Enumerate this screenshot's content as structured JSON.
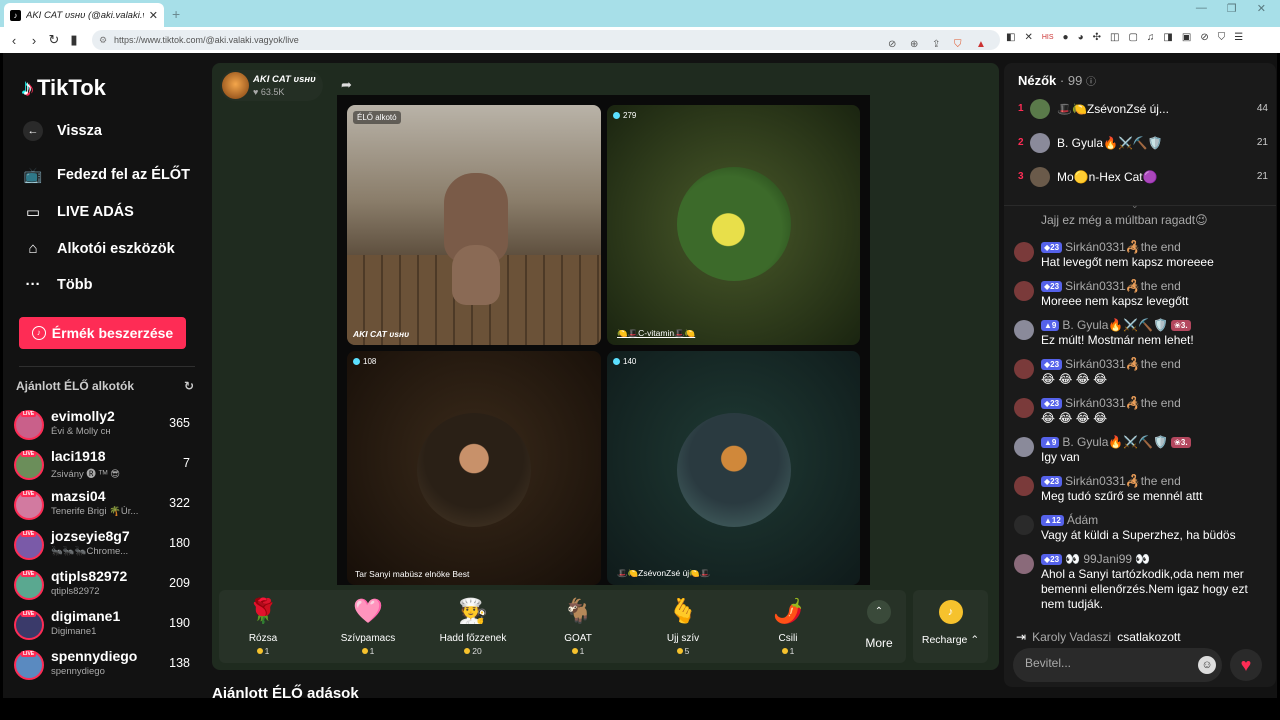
{
  "browser": {
    "tab_title": "AKI CAT ᴜsʜᴜ (@aki.valaki.va",
    "new_tab": "+",
    "url": "https://www.tiktok.com/@aki.valaki.vagyok/live"
  },
  "sidebar": {
    "logo": "TikTok",
    "back": "Vissza",
    "nav": [
      {
        "label": "Fedezd fel az ÉLŐT",
        "icon": "live-tv-icon"
      },
      {
        "label": "LIVE ADÁS",
        "icon": "camera-icon"
      },
      {
        "label": "Alkotói eszközök",
        "icon": "home-play-icon"
      },
      {
        "label": "Több",
        "icon": "more-dots-icon"
      }
    ],
    "coins_button": "Érmék beszerzése",
    "recommended_heading": "Ajánlott ÉLŐ alkotók",
    "live_badge": "LIVE",
    "recommended": [
      {
        "name": "evimolly2",
        "sub": "Évi & Molly ᴄʜ",
        "count": "365",
        "color": "#c9608a"
      },
      {
        "name": "laci1918",
        "sub": "Zsivány 🅡 ᵀᴹ 😎",
        "count": "7",
        "color": "#6b8e5a"
      },
      {
        "name": "mazsi04",
        "sub": "Tenerife Brigi 🌴Úr...",
        "count": "322",
        "color": "#d27aa0"
      },
      {
        "name": "jozseyie8g7",
        "sub": "🐜🐜🐜Chrome...",
        "count": "180",
        "color": "#7a5aa8"
      },
      {
        "name": "qtipls82972",
        "sub": "qtipls82972",
        "count": "209",
        "color": "#5aa890"
      },
      {
        "name": "digimane1",
        "sub": "Digimane1",
        "count": "190",
        "color": "#3a3a6a"
      },
      {
        "name": "spennydiego",
        "sub": "spennydiego",
        "count": "138",
        "color": "#5a8ac0"
      }
    ]
  },
  "stream": {
    "host_name": "AKI CAT ᴜsʜᴜ",
    "likes": "♥ 63.5K",
    "cells": [
      {
        "tag": "ÉLŐ alkotó",
        "caption": "AKI CAT ᴜsʜᴜ"
      },
      {
        "viewers": "279",
        "caption": "🍋🎩C-vitamin🎩🍋"
      },
      {
        "viewers": "108",
        "caption": "Tar Sanyi mabüsz elnöke Best"
      },
      {
        "viewers": "140",
        "caption": "🎩🍋ZsévonZsé új🍋🎩"
      }
    ]
  },
  "gifts": [
    {
      "name": "Rózsa",
      "price": "1",
      "icon": "🌹"
    },
    {
      "name": "Szívpamacs",
      "price": "1",
      "icon": "🩷"
    },
    {
      "name": "Hadd főzzenek",
      "price": "20",
      "icon": "🧑‍🍳"
    },
    {
      "name": "GOAT",
      "price": "1",
      "icon": "🐐"
    },
    {
      "name": "Ujj szív",
      "price": "5",
      "icon": "🫰"
    },
    {
      "name": "Csili",
      "price": "1",
      "icon": "🌶️"
    }
  ],
  "gift_more": "More",
  "recharge": "Recharge",
  "suggested_heading": "Ajánlott ÉLŐ adások",
  "chat": {
    "viewers_label": "Nézők",
    "viewers_count": "· 99",
    "top_viewers": [
      {
        "rank": "1",
        "name": "🎩🍋ZsévonZsé új...",
        "score": "44",
        "color": "#5a7a4a"
      },
      {
        "rank": "2",
        "name": "B. Gyula🔥⚔️⛏️🛡️",
        "score": "21",
        "color": "#8a8a9a"
      },
      {
        "rank": "3",
        "name": "Mo🟡n-Hex Cat🟣",
        "score": "21",
        "color": "#6a5a4a"
      }
    ],
    "messages": [
      {
        "user": "",
        "badge": "",
        "extra": "",
        "body": "Jajj ez még a múltban ragadt😉",
        "color": "#444"
      },
      {
        "user": "Sirkán0331🦂the end",
        "badge": "◆23",
        "extra": "",
        "body": "Hat levegőt nem kapsz moreeee",
        "color": "#7a3a3a"
      },
      {
        "user": "Sirkán0331🦂the end",
        "badge": "◆23",
        "extra": "",
        "body": "Moreee nem kapsz levegőtt",
        "color": "#7a3a3a"
      },
      {
        "user": "B. Gyula🔥⚔️⛏️🛡️",
        "badge": "▲9",
        "extra": "❀3.",
        "body": "Ez múlt! Mostmár nem lehet!",
        "color": "#8a8a9a"
      },
      {
        "user": "Sirkán0331🦂the end",
        "badge": "◆23",
        "extra": "",
        "body": "😂 😂 😂 😂",
        "color": "#7a3a3a"
      },
      {
        "user": "Sirkán0331🦂the end",
        "badge": "◆23",
        "extra": "",
        "body": "😂 😂 😂 😂",
        "color": "#7a3a3a"
      },
      {
        "user": "B. Gyula🔥⚔️⛏️🛡️",
        "badge": "▲9",
        "extra": "❀3.",
        "body": "Igy van",
        "color": "#8a8a9a"
      },
      {
        "user": "Sirkán0331🦂the end",
        "badge": "◆23",
        "extra": "",
        "body": "Meg tudó szűrő se mennél attt",
        "color": "#7a3a3a"
      },
      {
        "user": "Ádám",
        "badge": "▲12",
        "extra": "",
        "body": "Vagy át küldi a Superzhez, ha büdös",
        "color": "#2a2a2a"
      },
      {
        "user": "👀 99Jani99 👀",
        "badge": "◆23",
        "extra": "",
        "body": "Ahol a Sanyi tartózkodik,oda nem mer bemenni ellenőrzés.Nem igaz hogy ezt nem tudják.",
        "color": "#8a6a7a"
      }
    ],
    "joined_user": "Karoly Vadaszi",
    "joined_text": "csatlakozott",
    "input_placeholder": "Bevitel..."
  }
}
